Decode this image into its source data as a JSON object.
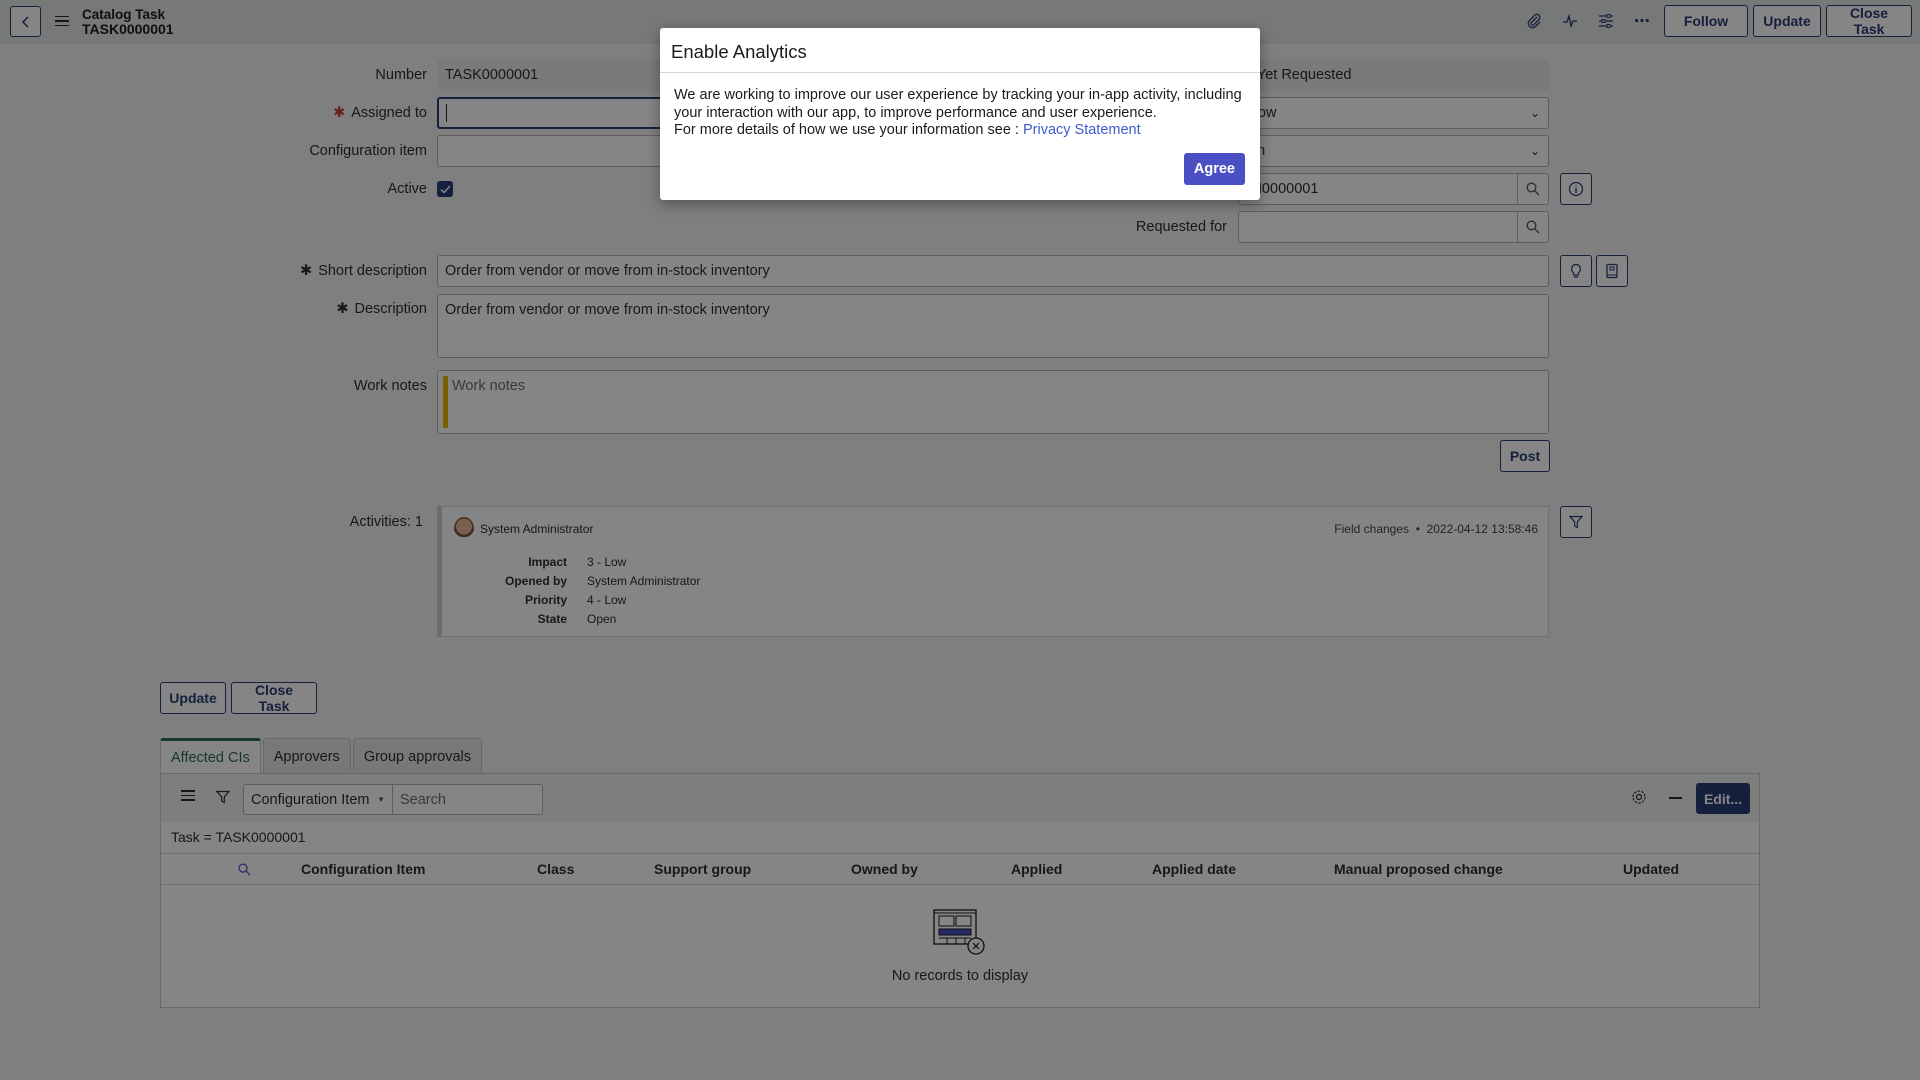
{
  "header": {
    "back_label": "Back",
    "title": "Catalog Task",
    "record_number": "TASK0000001",
    "icons": [
      "paperclip-icon",
      "activity-pulse-icon",
      "sliders-icon",
      "more-icon"
    ],
    "buttons": {
      "follow": "Follow",
      "update": "Update",
      "close_task": "Close Task"
    }
  },
  "form": {
    "number": {
      "label": "Number",
      "value": "TASK0000001"
    },
    "assigned_to": {
      "label": "Assigned to",
      "value": "",
      "required": true
    },
    "configuration_item": {
      "label": "Configuration item",
      "value": ""
    },
    "active": {
      "label": "Active",
      "checked": true
    },
    "approval": {
      "value": "Not Yet Requested",
      "visible_value": "ot Yet Requested"
    },
    "priority": {
      "value": "4 - Low",
      "visible_value": "- Low"
    },
    "state": {
      "value": "Open",
      "visible_value": "pen"
    },
    "request_item": {
      "value": "RITM0000001",
      "visible_value": "TM0000001"
    },
    "requested_for": {
      "label": "Requested for",
      "value": ""
    },
    "short_description": {
      "label": "Short description",
      "value": "Order from vendor or move from in-stock inventory"
    },
    "description": {
      "label": "Description",
      "value": "Order from vendor or move from in-stock inventory"
    },
    "work_notes": {
      "label": "Work notes",
      "placeholder": "Work notes"
    },
    "post_label": "Post",
    "required_marker": "✱"
  },
  "activity": {
    "label": "Activities: 1",
    "user": "System Administrator",
    "type": "Field changes",
    "timestamp": "2022-04-12 13:58:46",
    "separator": "•",
    "changes": [
      {
        "field": "Impact",
        "value": "3 - Low"
      },
      {
        "field": "Opened by",
        "value": "System Administrator"
      },
      {
        "field": "Priority",
        "value": "4 - Low"
      },
      {
        "field": "State",
        "value": "Open"
      }
    ]
  },
  "bottom_buttons": {
    "update": "Update",
    "close_task": "Close Task"
  },
  "related_lists": {
    "tabs": [
      {
        "label": "Affected CIs",
        "active": true
      },
      {
        "label": "Approvers",
        "active": false
      },
      {
        "label": "Group approvals",
        "active": false
      }
    ],
    "search_field": "Configuration Item",
    "search_placeholder": "Search",
    "edit_label": "Edit...",
    "breadcrumb": "Task = TASK0000001",
    "columns": [
      "Configuration Item",
      "Class",
      "Support group",
      "Owned by",
      "Applied",
      "Applied date",
      "Manual proposed change",
      "Updated"
    ],
    "rows": [],
    "empty_message": "No records to display"
  },
  "modal": {
    "title": "Enable Analytics",
    "body_line1": "We are working to improve our user experience by tracking your in-app activity, including your interaction with our app, to improve performance and user experience.",
    "body_line2": "For more details of how we use your information see : ",
    "link_text": "Privacy Statement",
    "agree_label": "Agree"
  },
  "colors": {
    "brand": "#293e75",
    "agree": "#4a4fc4",
    "link": "#3e5ccc",
    "active_tab": "#2e6b4e",
    "required": "#c83c36",
    "work_notes_bar": "#e6b800"
  }
}
